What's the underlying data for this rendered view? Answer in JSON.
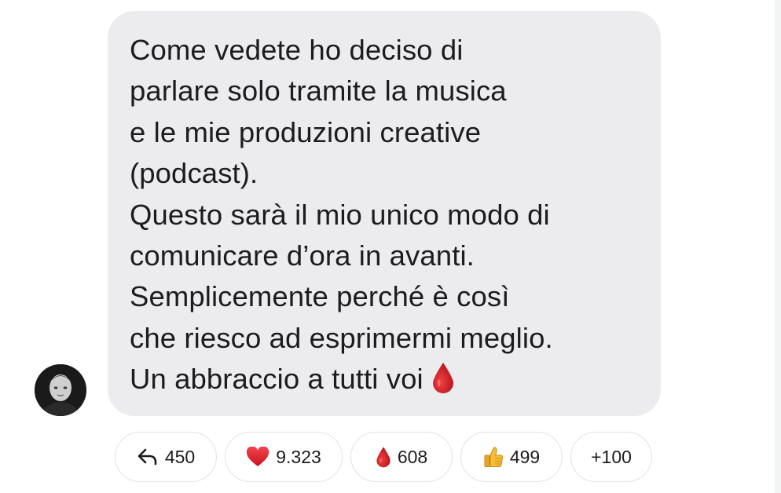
{
  "message": {
    "lines": [
      "Come vedete ho deciso di",
      "parlare solo tramite la musica",
      "e le mie produzioni creative",
      "(podcast).",
      "Questo sarà il mio unico modo di",
      "comunicare d’ora in avanti.",
      "Semplicemente perché è così",
      "che riesco ad esprimermi meglio.",
      "Un abbraccio a tutti voi"
    ],
    "trailing_emoji": "blood-drop-icon"
  },
  "reactions": {
    "reply": {
      "icon": "reply-arrow-icon",
      "count": "450"
    },
    "heart": {
      "icon": "red-heart-icon",
      "count": "9.323",
      "color": "#e0242e"
    },
    "drop": {
      "icon": "blood-drop-icon",
      "count": "608",
      "color": "#d11a23"
    },
    "thumb": {
      "icon": "thumbs-up-icon",
      "count": "499",
      "color": "#f5b52e"
    },
    "more": {
      "label": "+100"
    }
  },
  "colors": {
    "bubble": "#ececee",
    "text": "#1c1c1e",
    "pill_border": "#e2e3e6"
  }
}
